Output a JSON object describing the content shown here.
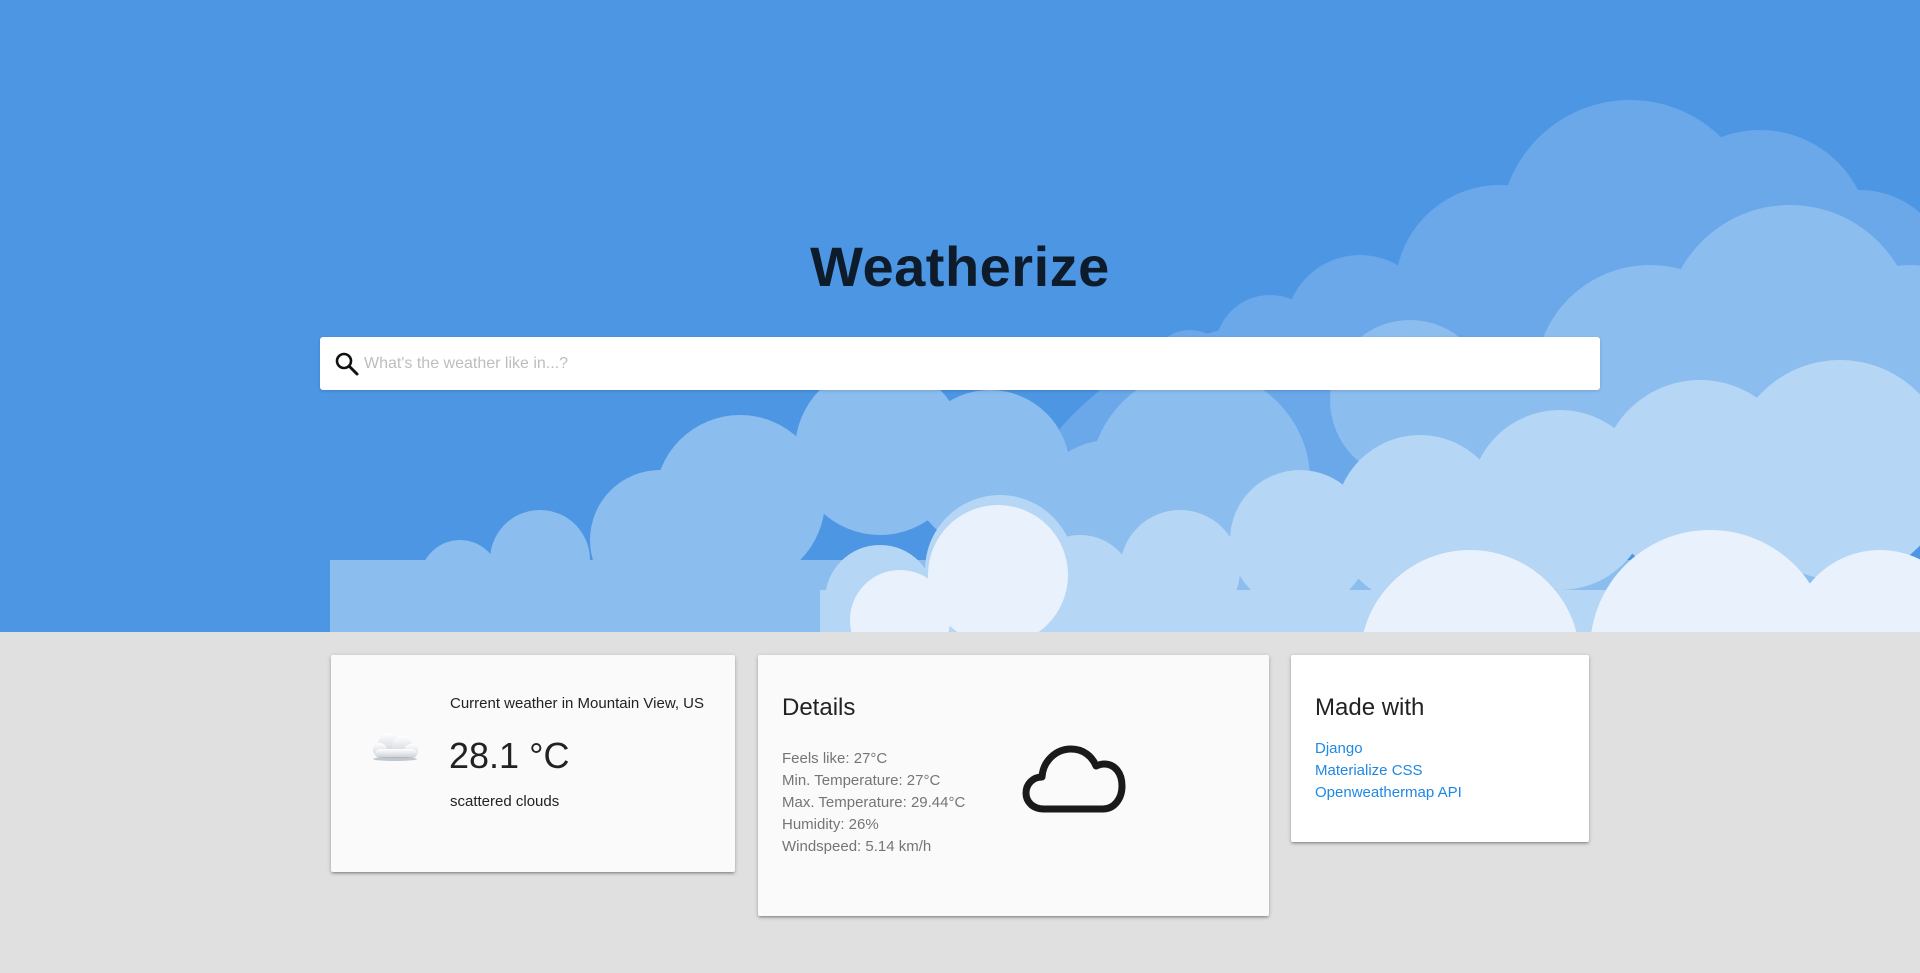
{
  "header": {
    "title": "Weatherize"
  },
  "search": {
    "placeholder": "What's the weather like in...?",
    "value": "",
    "icon": "search-icon"
  },
  "current": {
    "location_text": "Current weather in Mountain View, US",
    "temperature": "28.1 °C",
    "description": "scattered clouds",
    "icon": "cloud-icon"
  },
  "details": {
    "title": "Details",
    "items": [
      "Feels like: 27°C",
      "Min. Temperature: 27°C",
      "Max. Temperature: 29.44°C",
      "Humidity: 26%",
      "Windspeed: 5.14 km/h"
    ],
    "icon": "cloud-outline-icon"
  },
  "made_with": {
    "title": "Made with",
    "links": [
      "Django",
      "Materialize CSS",
      "Openweathermap API"
    ]
  },
  "colors": {
    "hero_bg": "#4d96e3",
    "page_bg": "#e0e0e0",
    "link": "#1e88e5"
  }
}
